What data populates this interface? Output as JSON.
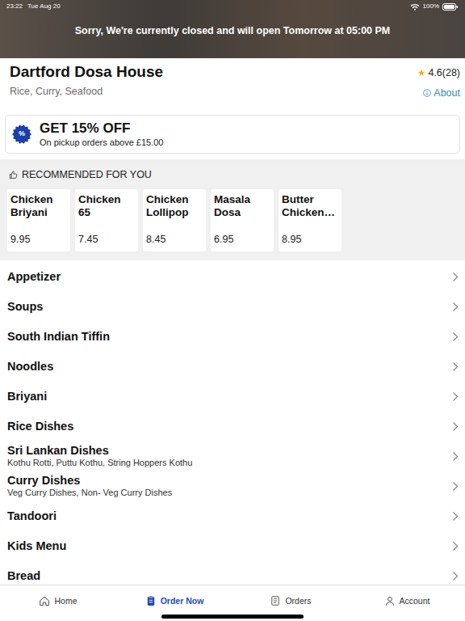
{
  "status_bar": {
    "time": "23:22",
    "date": "Tue Aug 20",
    "battery": "100%"
  },
  "banner": {
    "message": "Sorry, We're currently closed and will open Tomorrow at 05:00 PM"
  },
  "restaurant": {
    "name": "Dartford Dosa House",
    "cuisines": "Rice, Curry, Seafood",
    "rating": "4.6(28)",
    "about": "About"
  },
  "offer": {
    "badge": "%",
    "title": "GET 15% OFF",
    "subtitle": "On pickup orders above £15.00"
  },
  "recommended": {
    "title": "RECOMMENDED FOR YOU",
    "items": [
      {
        "name": "Chicken Briyani",
        "price": "9.95"
      },
      {
        "name": "Chicken 65",
        "price": "7.45"
      },
      {
        "name": "Chicken Lollipop",
        "price": "8.45"
      },
      {
        "name": "Masala Dosa",
        "price": "6.95"
      },
      {
        "name": "Butter Chicken…",
        "price": "8.95"
      }
    ]
  },
  "menu": [
    {
      "name": "Appetizer"
    },
    {
      "name": "Soups"
    },
    {
      "name": "South Indian Tiffin"
    },
    {
      "name": "Noodles"
    },
    {
      "name": "Briyani"
    },
    {
      "name": "Rice Dishes"
    },
    {
      "name": "Sri Lankan Dishes",
      "subtitle": "Kothu Rotti, Puttu Kothu, String Hoppers Kothu"
    },
    {
      "name": "Curry Dishes",
      "subtitle": "Veg Curry Dishes, Non- Veg Curry Dishes"
    },
    {
      "name": "Tandoori"
    },
    {
      "name": "Kids Menu"
    },
    {
      "name": "Bread"
    }
  ],
  "nav": [
    {
      "label": "Home",
      "selected": false
    },
    {
      "label": "Order Now",
      "selected": true
    },
    {
      "label": "Orders",
      "selected": false
    },
    {
      "label": "Account",
      "selected": false
    }
  ]
}
